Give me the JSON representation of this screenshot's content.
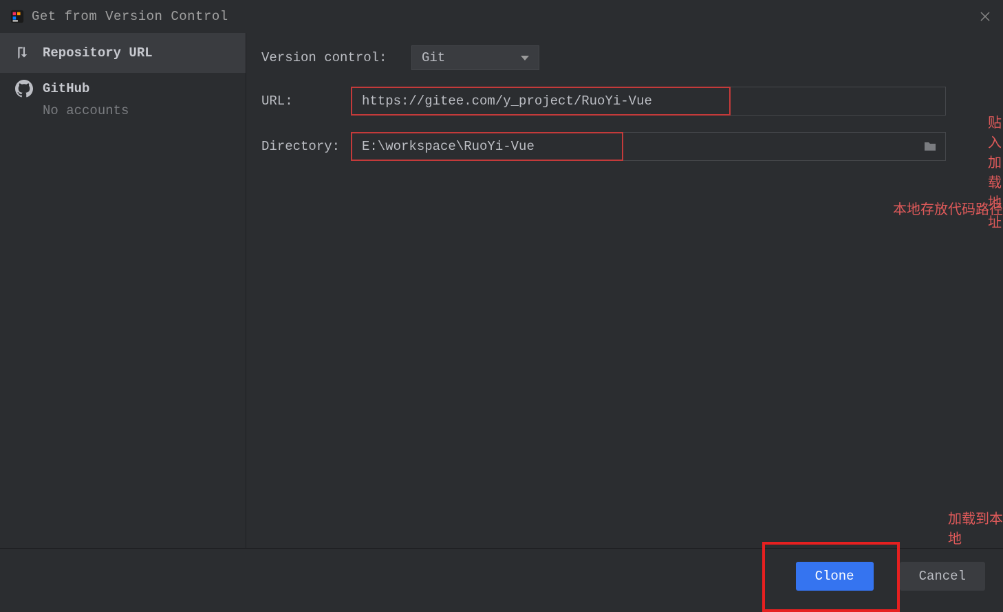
{
  "titlebar": {
    "title": "Get from Version Control"
  },
  "sidebar": {
    "repo_url_label": "Repository URL",
    "github_label": "GitHub",
    "no_accounts": "No accounts"
  },
  "form": {
    "vcs_label": "Version control:",
    "vcs_value": "Git",
    "url_label": "URL:",
    "url_value": "https://gitee.com/y_project/RuoYi-Vue",
    "dir_label": "Directory:",
    "dir_value": "E:\\workspace\\RuoYi-Vue"
  },
  "annotations": {
    "url": "贴入加载地址",
    "dir": "本地存放代码路径",
    "clone": "加载到本地"
  },
  "footer": {
    "clone": "Clone",
    "cancel": "Cancel"
  }
}
